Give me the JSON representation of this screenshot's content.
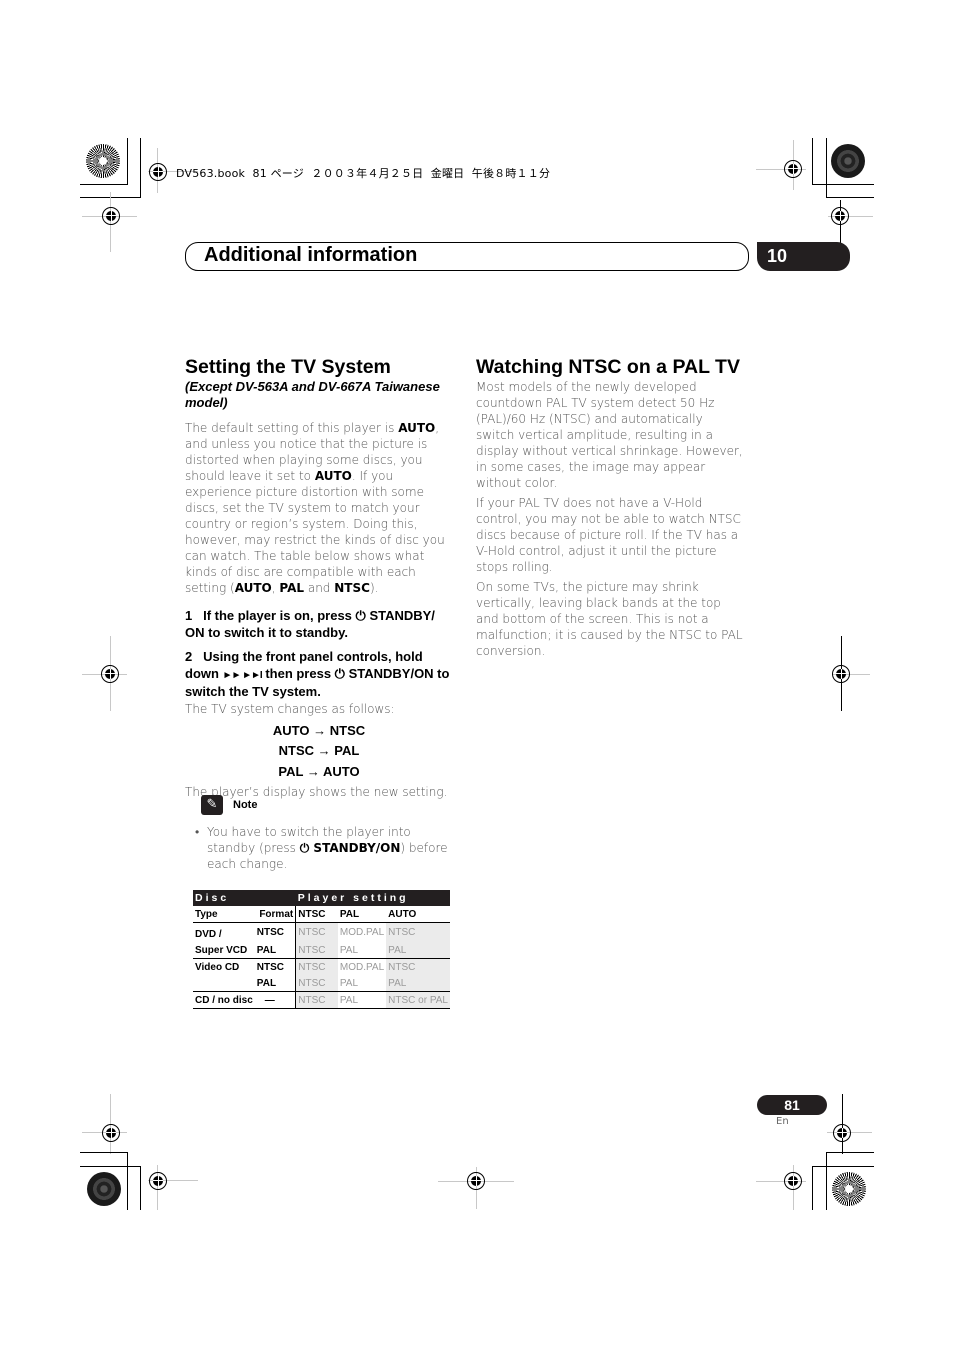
{
  "print_header": {
    "text": "DV563.book  81 ページ  ２００３年４月２５日  金曜日  午後８時１１分"
  },
  "chapter": {
    "title": "Additional information",
    "number": "10"
  },
  "left_column": {
    "heading": "Setting the TV System",
    "subheading": "(Except DV-563A and DV-667A Taiwanese model)",
    "intro": {
      "p1": "The default setting of this player is ",
      "b1": "AUTO",
      "p2": ", and unless you notice that the picture is distorted when playing some discs, you should leave it set to ",
      "b2": "AUTO",
      "p3": ". If you experience picture distortion with some discs, set the TV system to match your country or region’s system. Doing this, however, may restrict the kinds of disc you can watch. The table below shows what kinds of disc are compatible with each setting (",
      "b3": "AUTO",
      "p4": ", ",
      "b4": "PAL",
      "p5": " and ",
      "b5": "NTSC",
      "p6": ")."
    },
    "step1": {
      "number": "1",
      "text_a": "If the player is on, press ",
      "icon": "power-icon",
      "text_b": " STANDBY/ ON to switch it to standby."
    },
    "step2": {
      "number": "2",
      "text_a": "Using the front panel controls, hold down ",
      "buttons": "►► ►►I",
      "text_b": " then press ",
      "icon": "power-icon",
      "text_c": " STANDBY/ON to switch the TV system."
    },
    "step2_desc": "The TV system changes as follows:",
    "sequence": [
      {
        "from": "AUTO",
        "to": "NTSC"
      },
      {
        "from": "NTSC",
        "to": "PAL"
      },
      {
        "from": "PAL",
        "to": "AUTO"
      }
    ],
    "arrow": "→",
    "after_sequence": "The player’s display shows the new setting.",
    "note": {
      "label": "Note",
      "icon": "pencil-icon",
      "bullet": "•",
      "text_a": "You have to switch the player into standby (press ",
      "bold": "STANDBY/ON",
      "text_b": ") before each change."
    },
    "table": {
      "group_headers": [
        "Disc",
        "Player setting"
      ],
      "columns": [
        "Type",
        "Format",
        "NTSC",
        "PAL",
        "AUTO"
      ],
      "rows": [
        [
          "DVD /",
          "NTSC",
          "NTSC",
          "MOD.PAL",
          "NTSC"
        ],
        [
          "Super VCD",
          "PAL",
          "NTSC",
          "PAL",
          "PAL"
        ],
        [
          "Video CD",
          "NTSC",
          "NTSC",
          "MOD.PAL",
          "NTSC"
        ],
        [
          "",
          "PAL",
          "NTSC",
          "PAL",
          "PAL"
        ],
        [
          "CD / no disc",
          "—",
          "NTSC",
          "PAL",
          "NTSC or PAL"
        ]
      ]
    }
  },
  "right_column": {
    "heading": "Watching NTSC on a PAL TV",
    "paragraphs": [
      "Most models of the newly developed countdown PAL TV system detect 50 Hz (PAL)/60 Hz (NTSC) and automatically switch vertical amplitude, resulting in a display without vertical shrinkage. However, in some cases, the image may appear without color.",
      "If your PAL TV does not have a V-Hold control, you may not be able to watch NTSC discs because of picture roll. If the TV has a V-Hold control, adjust it until the picture stops rolling.",
      "On some TVs, the picture may shrink vertically, leaving black bands at the top and bottom of the screen. This is not a malfunction; it is caused by the NTSC to PAL conversion."
    ]
  },
  "footer": {
    "page_number": "81",
    "language": "En"
  }
}
